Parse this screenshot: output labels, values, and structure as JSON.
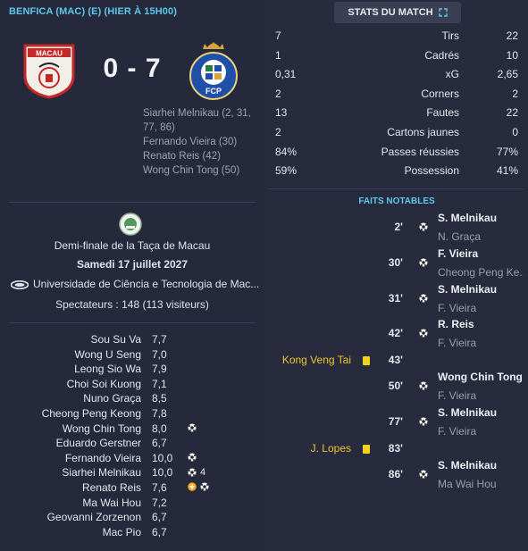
{
  "match": {
    "header": "BENFICA (MAC) (E) (HIER À 15H00)",
    "score": "0 - 7",
    "home_crest_text": "MACAU",
    "away_crest_text": "FCP",
    "scorers": [
      "Siarhei Melnikau (2, 31,",
      "77, 86)",
      "Fernando Vieira (30)",
      "Renato Reis (42)",
      "Wong Chin Tong (50)"
    ]
  },
  "info": {
    "competition": "Demi-finale de la Taça de Macau",
    "date": "Samedi 17 juillet 2027",
    "venue": "Universidade de Ciência e Tecnologia de Mac...",
    "spectators": "Spectateurs : 148 (113 visiteurs)"
  },
  "ratings": [
    {
      "name": "Sou Su Va",
      "rating": "7,7",
      "icons": []
    },
    {
      "name": "Wong U Seng",
      "rating": "7,0",
      "icons": []
    },
    {
      "name": "Leong Sio Wa",
      "rating": "7,9",
      "icons": []
    },
    {
      "name": "Choi Soi Kuong",
      "rating": "7,1",
      "icons": []
    },
    {
      "name": "Nuno Graça",
      "rating": "8,5",
      "icons": []
    },
    {
      "name": "Cheong Peng Keong",
      "rating": "7,8",
      "icons": []
    },
    {
      "name": "Wong Chin Tong",
      "rating": "8,0",
      "icons": [
        "ball"
      ]
    },
    {
      "name": "Eduardo Gerstner",
      "rating": "6,7",
      "icons": []
    },
    {
      "name": "Fernando Vieira",
      "rating": "10,0",
      "icons": [
        "ball"
      ]
    },
    {
      "name": "Siarhei Melnikau",
      "rating": "10,0",
      "icons": [
        "ball"
      ],
      "count": "4"
    },
    {
      "name": "Renato Reis",
      "rating": "7,6",
      "icons": [
        "sub",
        "ball"
      ]
    },
    {
      "name": "Ma Wai Hou",
      "rating": "7,2",
      "icons": []
    },
    {
      "name": "Geovanni Zorzenon",
      "rating": "6,7",
      "icons": []
    },
    {
      "name": "Mac Pio",
      "rating": "6,7",
      "icons": []
    }
  ],
  "stats_button": "STATS DU MATCH",
  "stats": [
    {
      "home": "7",
      "label": "Tirs",
      "away": "22"
    },
    {
      "home": "1",
      "label": "Cadrés",
      "away": "10"
    },
    {
      "home": "0,31",
      "label": "xG",
      "away": "2,65"
    },
    {
      "home": "2",
      "label": "Corners",
      "away": "2"
    },
    {
      "home": "13",
      "label": "Fautes",
      "away": "22"
    },
    {
      "home": "2",
      "label": "Cartons jaunes",
      "away": "0"
    },
    {
      "home": "84%",
      "label": "Passes réussies",
      "away": "77%"
    },
    {
      "home": "59%",
      "label": "Possession",
      "away": "41%"
    }
  ],
  "faits_title": "FAITS NOTABLES",
  "events": [
    {
      "minute": "2'",
      "type": "goal",
      "player": "S. Melnikau",
      "assist": "N. Graça"
    },
    {
      "minute": "30'",
      "type": "goal",
      "player": "F. Vieira",
      "assist": "Cheong Peng Ke..."
    },
    {
      "minute": "31'",
      "type": "goal",
      "player": "S. Melnikau",
      "assist": "F. Vieira"
    },
    {
      "minute": "42'",
      "type": "goal",
      "player": "R. Reis",
      "assist": "F. Vieira"
    },
    {
      "minute": "43'",
      "type": "yellow",
      "home_player": "Kong Veng Tai"
    },
    {
      "minute": "50'",
      "type": "goal",
      "player": "Wong Chin Tong",
      "assist": "F. Vieira"
    },
    {
      "minute": "77'",
      "type": "goal",
      "player": "S. Melnikau",
      "assist": "F. Vieira"
    },
    {
      "minute": "83'",
      "type": "yellow",
      "home_player": "J. Lopes"
    },
    {
      "minute": "86'",
      "type": "goal",
      "player": "S. Melnikau",
      "assist": "Ma Wai Hou"
    }
  ],
  "colors": {
    "accent": "#5ec8ea",
    "yellow_card": "#f2d21a",
    "home_red": "#c62828",
    "away_blue": "#1f4fa8"
  }
}
